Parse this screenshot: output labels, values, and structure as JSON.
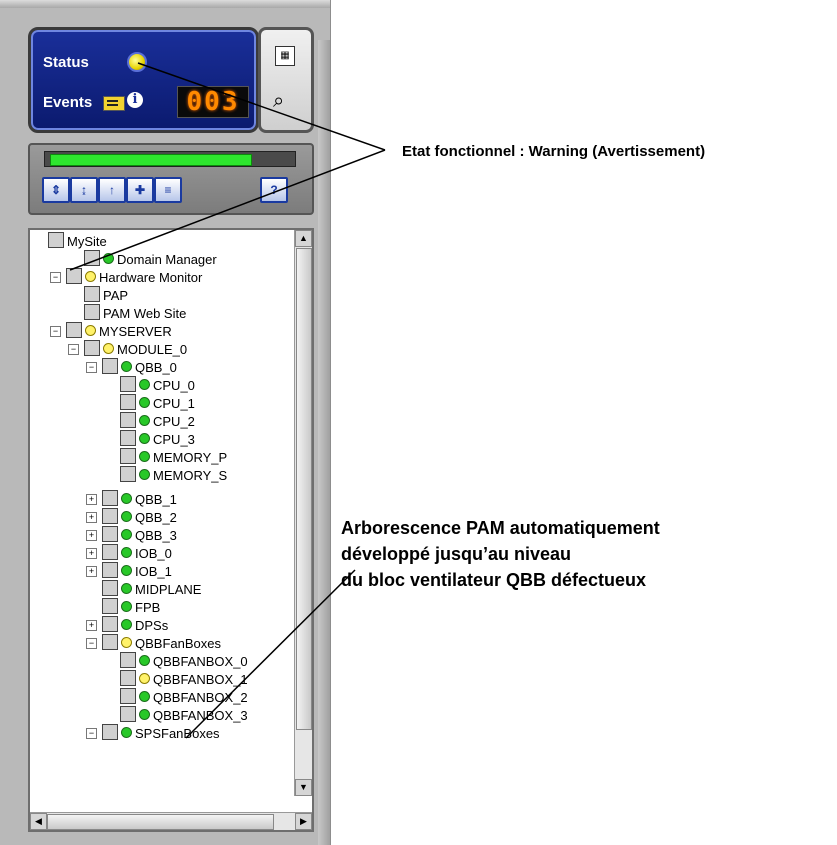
{
  "status_panel": {
    "status_label": "Status",
    "events_label": "Events",
    "event_counter": "003"
  },
  "health_bar": {
    "level_percent": 100,
    "color": "#2ee62e"
  },
  "toolbar": {
    "buttons": [
      {
        "icon": "sort-updown-icon",
        "glyph": "⇕"
      },
      {
        "icon": "expand-list-icon",
        "glyph": "↨"
      },
      {
        "icon": "collapse-list-icon",
        "glyph": "↑"
      },
      {
        "icon": "add-node-icon",
        "glyph": "✚"
      },
      {
        "icon": "stack-icon",
        "glyph": "≡"
      },
      {
        "icon": "help-icon",
        "glyph": "?"
      }
    ]
  },
  "tree": {
    "nodes": [
      {
        "label": "MySite",
        "status": "none"
      },
      {
        "label": "Domain Manager",
        "status": "green"
      },
      {
        "label": "Hardware Monitor",
        "status": "yellow"
      },
      {
        "label": "PAP",
        "status": "none"
      },
      {
        "label": "PAM Web Site",
        "status": "none"
      },
      {
        "label": "MYSERVER",
        "status": "yellow"
      },
      {
        "label": "MODULE_0",
        "status": "yellow"
      },
      {
        "label": "QBB_0",
        "status": "green"
      },
      {
        "label": "CPU_0",
        "status": "green"
      },
      {
        "label": "CPU_1",
        "status": "green"
      },
      {
        "label": "CPU_2",
        "status": "green"
      },
      {
        "label": "CPU_3",
        "status": "green"
      },
      {
        "label": "MEMORY_P",
        "status": "green"
      },
      {
        "label": "MEMORY_S",
        "status": "green"
      },
      {
        "label": "QBB_1",
        "status": "green"
      },
      {
        "label": "QBB_2",
        "status": "green"
      },
      {
        "label": "QBB_3",
        "status": "green"
      },
      {
        "label": "IOB_0",
        "status": "green"
      },
      {
        "label": "IOB_1",
        "status": "green"
      },
      {
        "label": "MIDPLANE",
        "status": "green"
      },
      {
        "label": "FPB",
        "status": "green"
      },
      {
        "label": "DPSs",
        "status": "green"
      },
      {
        "label": "QBBFanBoxes",
        "status": "yellow"
      },
      {
        "label": "QBBFANBOX_0",
        "status": "green"
      },
      {
        "label": "QBBFANBOX_1",
        "status": "yellow"
      },
      {
        "label": "QBBFANBOX_2",
        "status": "green"
      },
      {
        "label": "QBBFANBOX_3",
        "status": "green"
      },
      {
        "label": "SPSFanBoxes",
        "status": "green"
      }
    ]
  },
  "callouts": {
    "warning": "Etat fonctionnel : Warning (Avertissement)",
    "tree_line1": "Arborescence PAM automatiquement",
    "tree_line2": "développé jusqu’au niveau",
    "tree_line3": "du bloc ventilateur QBB défectueux"
  }
}
